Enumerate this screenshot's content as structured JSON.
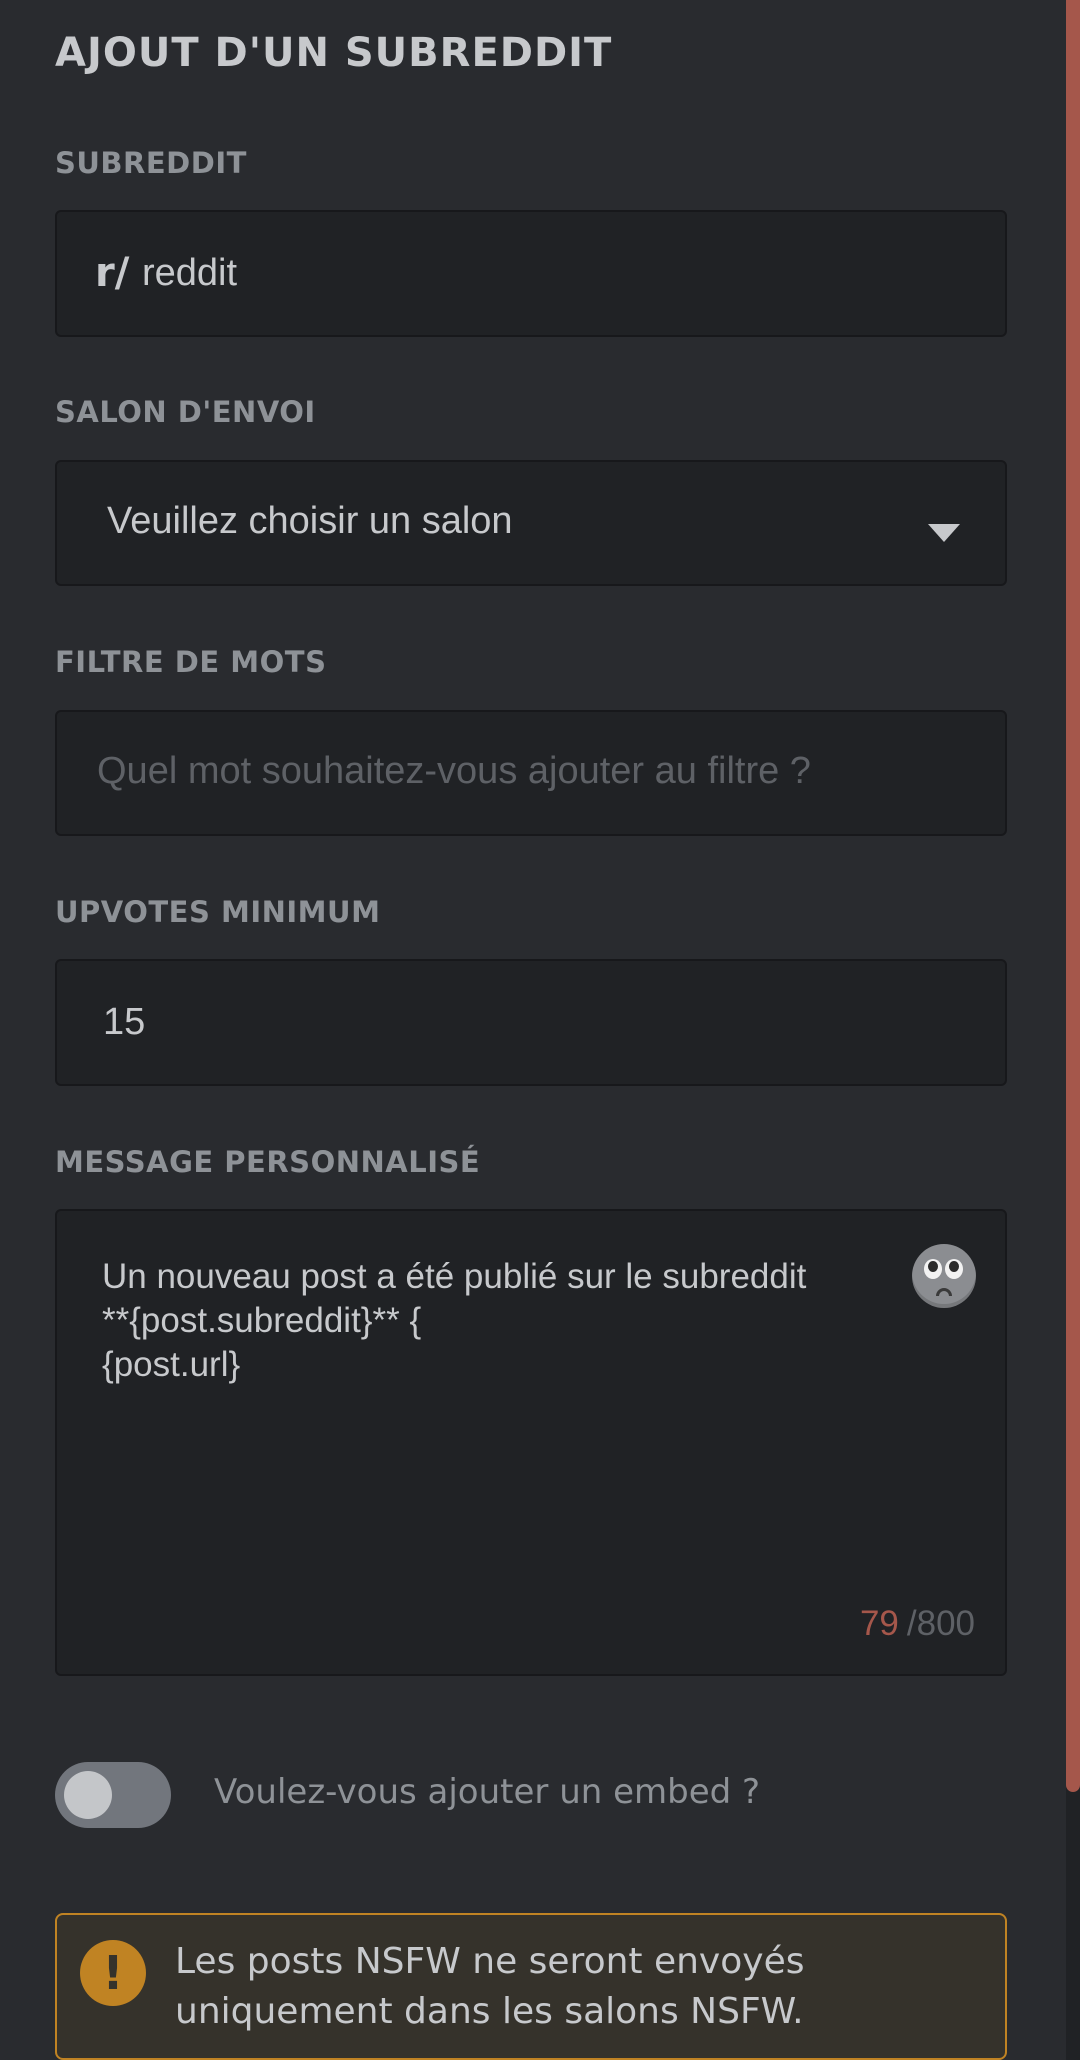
{
  "page": {
    "title": "AJOUT D'UN SUBREDDIT"
  },
  "subreddit": {
    "label": "SUBREDDIT",
    "prefix": "r/",
    "value": "reddit"
  },
  "channel": {
    "label": "SALON D'ENVOI",
    "selected": "Veuillez choisir un salon"
  },
  "word_filter": {
    "label": "FILTRE DE MOTS",
    "placeholder": "Quel mot souhaitez-vous ajouter au filtre ?"
  },
  "min_upvotes": {
    "label": "UPVOTES MINIMUM",
    "value": "15"
  },
  "custom_message": {
    "label": "MESSAGE PERSONNALISÉ",
    "value": "Un nouveau post a été publié sur le subreddit\n**{post.subreddit}** {\n{post.url}",
    "count_current": "79",
    "count_max": "/800",
    "emoji_icon": "pleading-face-emoji"
  },
  "embed": {
    "label": "Voulez-vous ajouter un embed ?",
    "enabled": false
  },
  "nsfw_warning": {
    "icon": "!",
    "text": "Les posts NSFW ne seront envoyés uniquement dans les salons NSFW."
  },
  "colors": {
    "background": "#292b2f",
    "input_background": "#202225",
    "accent": "#a5574b",
    "warning": "#c08323"
  }
}
